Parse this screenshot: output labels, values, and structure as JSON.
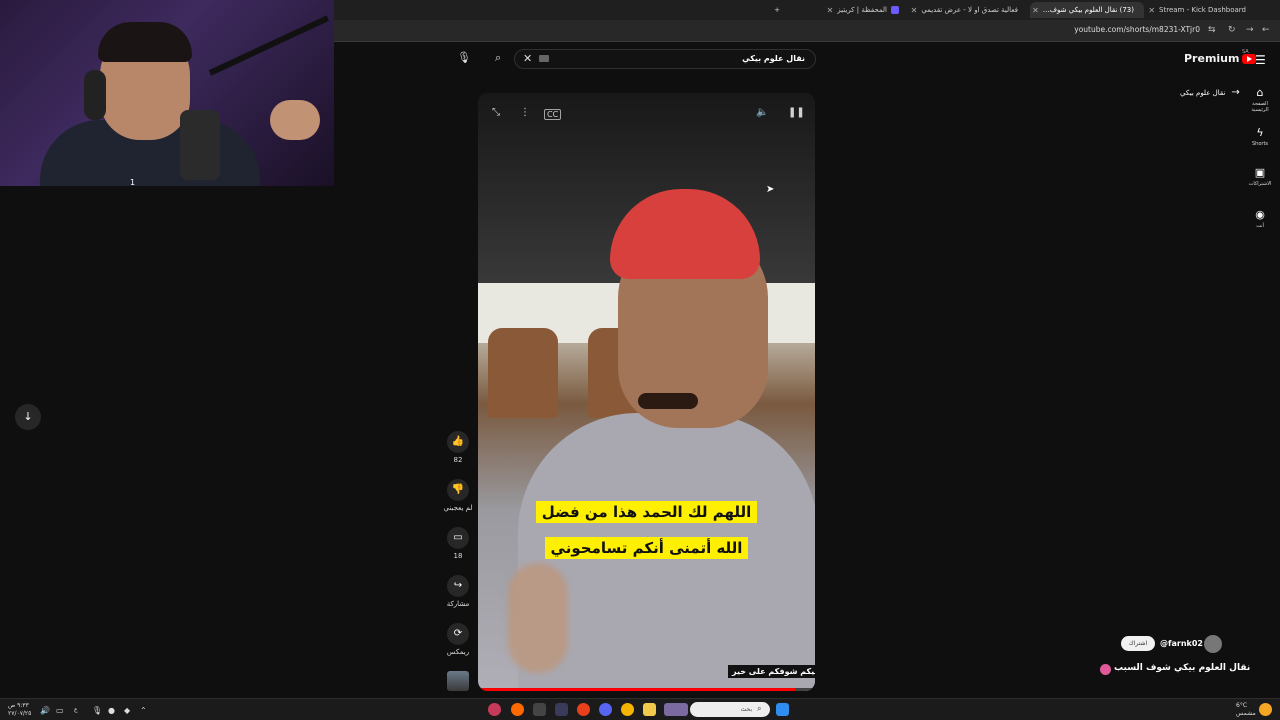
{
  "browser": {
    "tabs": [
      {
        "label": "Stream - Kick Dashboard",
        "active": false
      },
      {
        "label": "(73) نقال العلوم بيكي شوف…",
        "active": true
      },
      {
        "label": "فعالية تصدق او لا - عرض تقديمي",
        "active": false
      },
      {
        "label": "المحفظة | كريتيز",
        "active": false
      }
    ],
    "new_tab": "+",
    "url": "youtube.com/shorts/m8231-XTjr0"
  },
  "webcam": {
    "overlay_number": "1"
  },
  "youtube": {
    "logo_text": "Premium",
    "country_code": "SA",
    "search_query": "نقال علوم بيكي",
    "back_label": "نقال علوم بيكي",
    "sidebar": [
      {
        "icon": "home-icon",
        "label": "الصفحة الرئيسية"
      },
      {
        "icon": "shorts-icon",
        "label": "Shorts"
      },
      {
        "icon": "subscriptions-icon",
        "label": "الاشتراكات"
      },
      {
        "icon": "you-icon",
        "label": "أنت"
      }
    ]
  },
  "short": {
    "caption_line1": "اللهم لك الحمد هذا من فضل",
    "caption_line2": "الله أتمنى أنكم تسامحوني",
    "ticker": "م عليكم شوفكم على خير",
    "progress": 0.94,
    "actions": {
      "like_count": "82",
      "dislike_label": "لم يعجبني",
      "comment_count": "18",
      "share_label": "مشاركة",
      "remix_label": "ريمكس"
    }
  },
  "channel": {
    "handle": "@farnk02",
    "subscribe_label": "اشتراك",
    "title": "نقال العلوم بيكي  شوف السبب"
  },
  "taskbar": {
    "search_placeholder": "بحث",
    "weather": "6°C",
    "weather_desc": "مشمس",
    "time": "٩:٣٣ ص",
    "date": "٢٧/٠٧/٢٥",
    "lang": "ع"
  },
  "colors": {
    "accent": "#ff0000",
    "caption_bg": "#ffef00",
    "background": "#0f0f0f"
  }
}
